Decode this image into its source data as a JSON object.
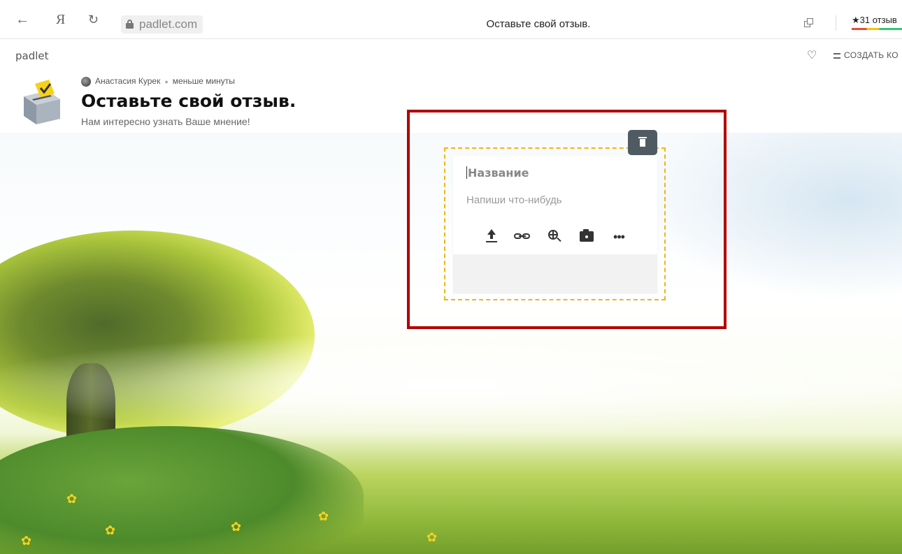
{
  "browser": {
    "back_icon": "←",
    "yandex_logo": "Я",
    "reload_icon": "↻",
    "url": "padlet.com",
    "tab_title": "Оставьте свой отзыв.",
    "reviews": "★31 отзыв"
  },
  "padlet_bar": {
    "logo": "padlet",
    "remake": "СОЗДАТЬ КО"
  },
  "board": {
    "author": "Анастасия Курек",
    "time_ago": "меньше минуты",
    "title": "Оставьте свой отзыв.",
    "description": "Нам интересно узнать Ваше мнение!"
  },
  "composer": {
    "title_placeholder": "Название",
    "body_placeholder": "Напиши что-нибудь",
    "more_label": "•••"
  },
  "colors": {
    "highlight": "#b30000",
    "dashed": "#f0b41c",
    "delete_bg": "#4f5a62"
  }
}
